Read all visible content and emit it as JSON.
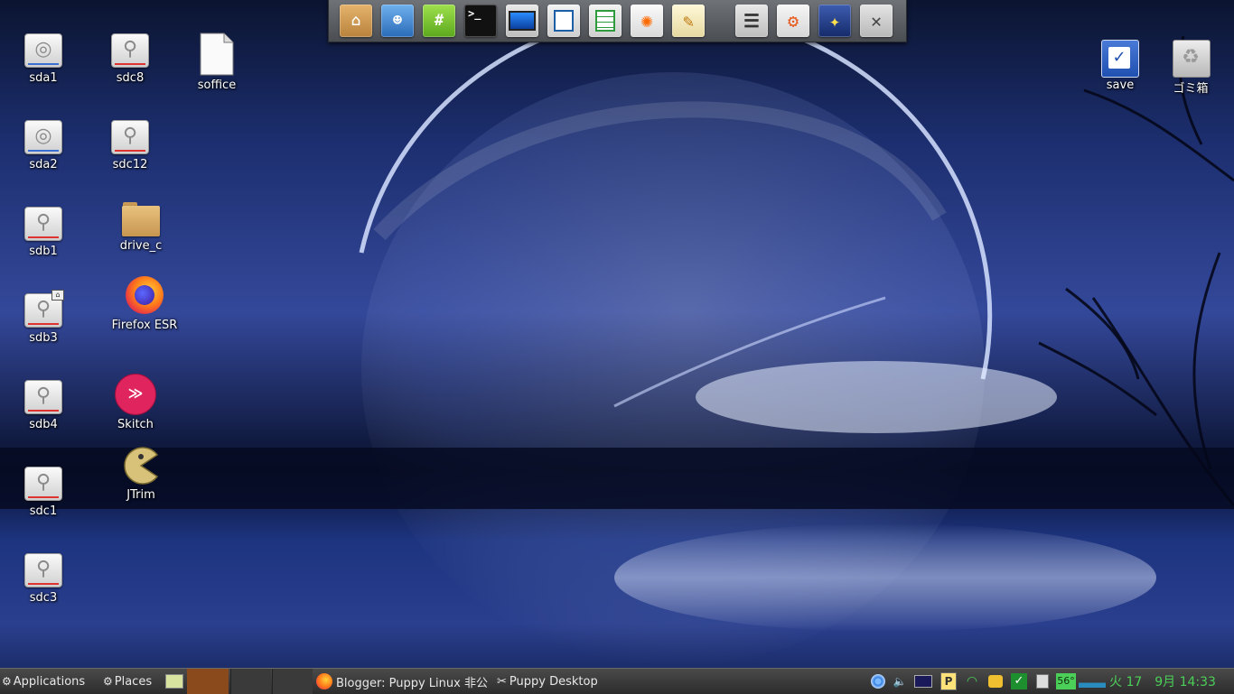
{
  "desktop": {
    "drives": [
      {
        "label": "sda1",
        "type": "hd"
      },
      {
        "label": "sda2",
        "type": "hd"
      },
      {
        "label": "sdb1",
        "type": "usb"
      },
      {
        "label": "sdb3",
        "type": "usb"
      },
      {
        "label": "sdb4",
        "type": "usb"
      },
      {
        "label": "sdc1",
        "type": "usb"
      },
      {
        "label": "sdc3",
        "type": "usb"
      },
      {
        "label": "sdc8",
        "type": "usb"
      },
      {
        "label": "sdc12",
        "type": "usb"
      }
    ],
    "icons": {
      "soffice": "soffice",
      "drive_c": "drive_c",
      "firefox": "Firefox ESR",
      "skitch": "Skitch",
      "jtrim": "JTrim",
      "save": "save",
      "trash": "ゴミ箱"
    }
  },
  "launcher": {
    "terminal_glyph": ">_",
    "chat_glyph": "#",
    "close_glyph": "✕",
    "items": [
      "home-folder",
      "contacts",
      "chat",
      "terminal",
      "display",
      "writer",
      "spreadsheet",
      "paint",
      "text-editor",
      "mixer",
      "settings",
      "wizard",
      "close"
    ]
  },
  "taskbar": {
    "applications": "Applications",
    "places": "Places",
    "task_firefox": "Blogger: Puppy Linux 非公",
    "task_desktop": "Puppy Desktop",
    "temperature": "56°",
    "clock": "火 17　9月 14:33",
    "tray_p": "P"
  },
  "colors": {
    "accent_green": "#4ccf58",
    "firefox_orange": "#ff7a1a",
    "skitch_red": "#e0245e"
  }
}
